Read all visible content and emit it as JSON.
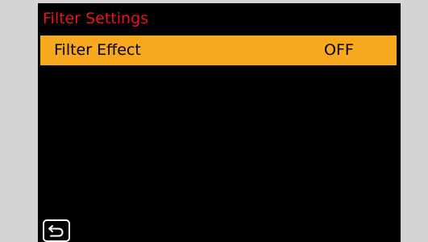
{
  "header": {
    "title": "Filter Settings"
  },
  "menu": {
    "items": [
      {
        "label": "Filter Effect",
        "value": "OFF",
        "selected": true
      }
    ]
  },
  "footer": {
    "back_icon": "return-arrow-icon"
  },
  "colors": {
    "title": "#e8141b",
    "highlight": "#f8a81c",
    "screen_background": "#000000",
    "side_panels": "#d4d4d4"
  }
}
